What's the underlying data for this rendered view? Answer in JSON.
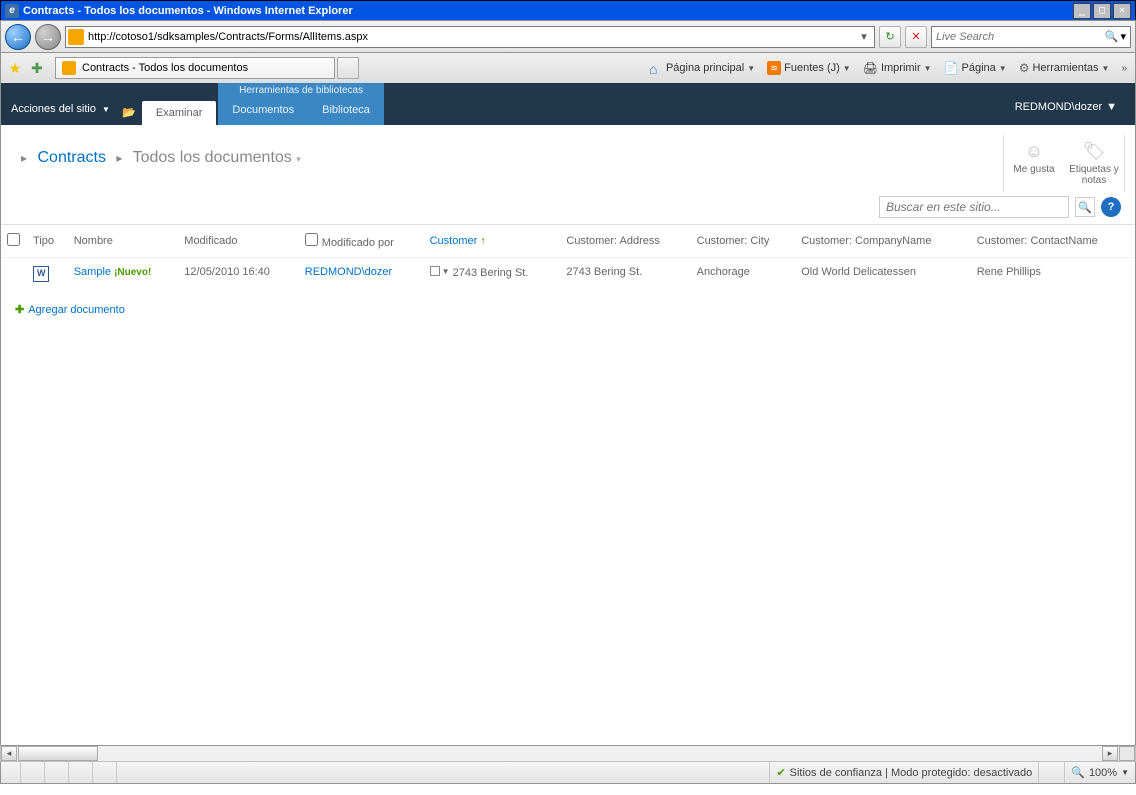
{
  "window": {
    "title": "Contracts - Todos los documentos - Windows Internet Explorer"
  },
  "nav": {
    "url": "http://cotoso1/sdksamples/Contracts/Forms/AllItems.aspx",
    "search_placeholder": "Live Search"
  },
  "tabs": {
    "page_title": "Contracts - Todos los documentos"
  },
  "commandbar": {
    "home": "Página principal",
    "feeds": "Fuentes (J)",
    "print": "Imprimir",
    "page": "Página",
    "tools": "Herramientas"
  },
  "ribbon": {
    "site_actions": "Acciones del sitio",
    "browse": "Examinar",
    "ctx_label": "Herramientas de bibliotecas",
    "documents": "Documentos",
    "library": "Biblioteca",
    "user": "REDMOND\\dozer"
  },
  "breadcrumb": {
    "list": "Contracts",
    "view": "Todos los documentos"
  },
  "social": {
    "like": "Me gusta",
    "tags": "Etiquetas y notas"
  },
  "sp_search": {
    "placeholder": "Buscar en este sitio..."
  },
  "columns": {
    "type": "Tipo",
    "name": "Nombre",
    "modified": "Modificado",
    "modified_by": "Modificado por",
    "customer": "Customer",
    "address": "Customer: Address",
    "city": "Customer: City",
    "company": "Customer: CompanyName",
    "contact": "Customer: ContactName"
  },
  "rows": [
    {
      "name": "Sample",
      "new_badge": "¡Nuevo!",
      "modified": "12/05/2010 16:40",
      "modified_by": "REDMOND\\dozer",
      "customer": "2743 Bering St.",
      "address": "2743 Bering St.",
      "city": "Anchorage",
      "company": "Old World Delicatessen",
      "contact": "Rene Phillips"
    }
  ],
  "add_doc": "Agregar documento",
  "statusbar": {
    "zone": "Sitios de confianza | Modo protegido: desactivado",
    "zoom": "100%"
  }
}
